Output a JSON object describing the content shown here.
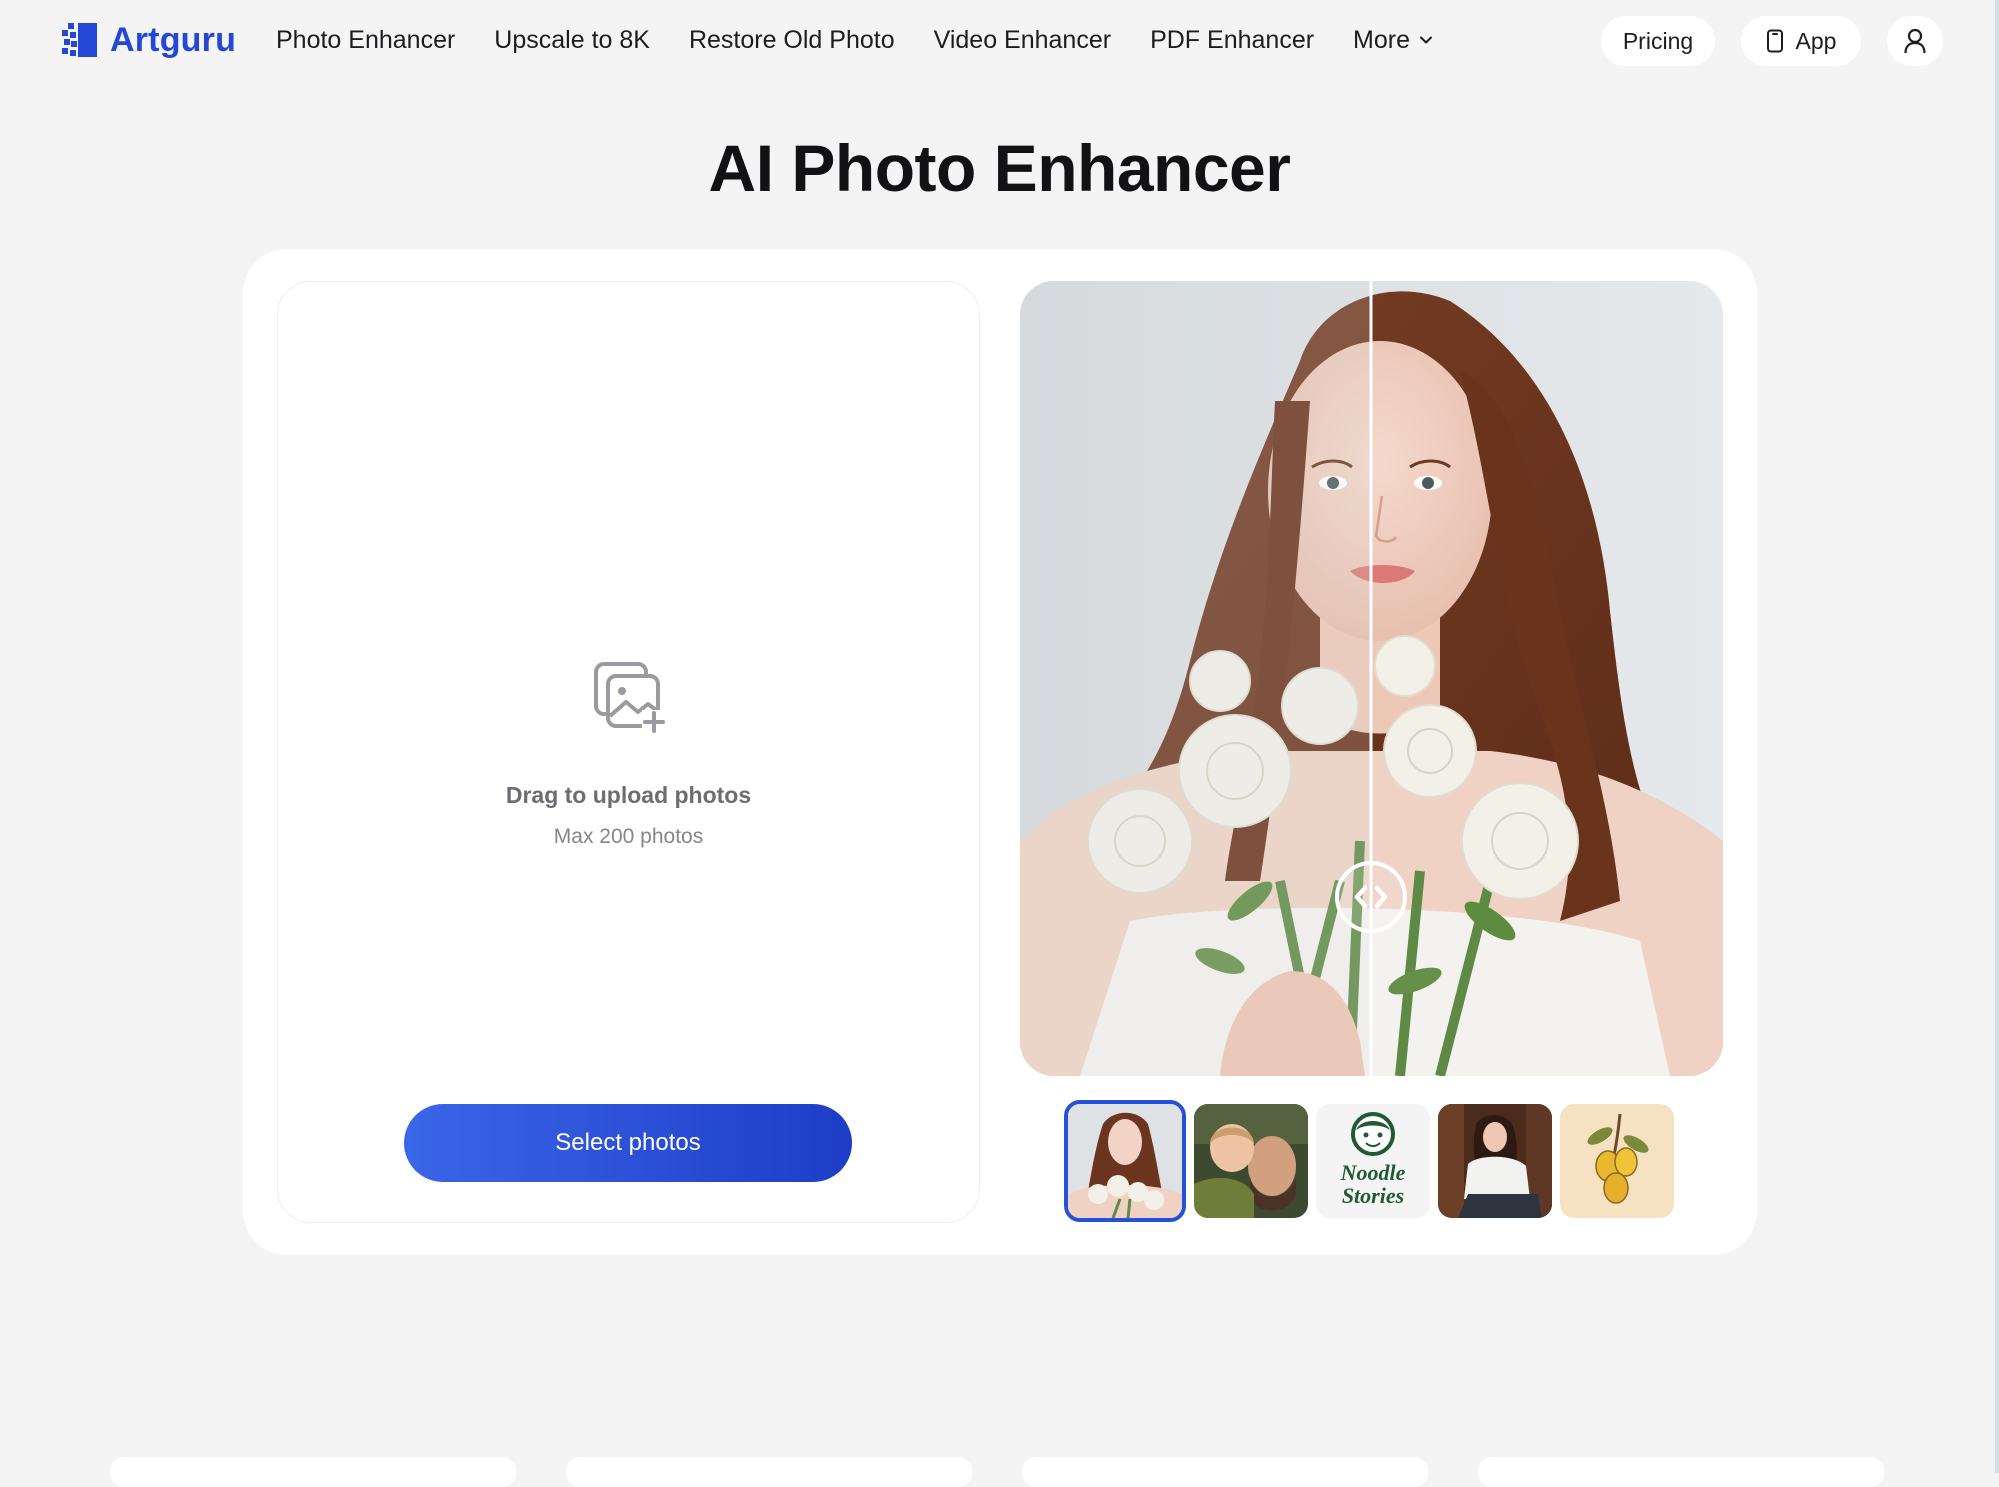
{
  "header": {
    "logo_text": "Artguru",
    "nav": [
      "Photo Enhancer",
      "Upscale to 8K",
      "Restore Old Photo",
      "Video Enhancer",
      "PDF Enhancer",
      "More"
    ],
    "pricing_label": "Pricing",
    "app_label": "App"
  },
  "main": {
    "title": "AI Photo Enhancer",
    "upload": {
      "prompt": "Drag to upload photos",
      "limit": "Max 200 photos",
      "button_label": "Select photos"
    },
    "thumbnails": [
      {
        "name": "woman-with-roses",
        "selected": true
      },
      {
        "name": "father-and-child",
        "selected": false
      },
      {
        "name": "Noodle Stories",
        "selected": false
      },
      {
        "name": "woman-sitting",
        "selected": false
      },
      {
        "name": "lemon-illustration",
        "selected": false
      }
    ],
    "thumbnail_logo_text": [
      "Noodle",
      "Stories"
    ]
  },
  "colors": {
    "brand": "#2348d8",
    "button": "#2b4fd6",
    "background": "#f4f4f5"
  }
}
